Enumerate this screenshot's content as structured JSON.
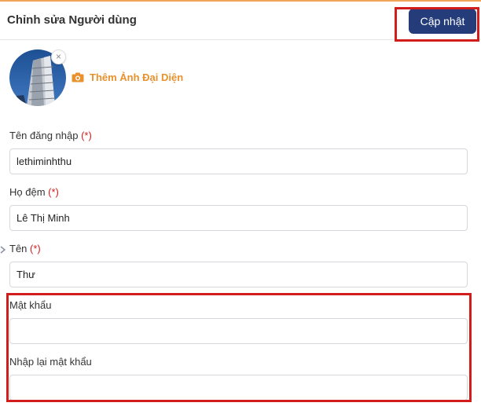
{
  "header": {
    "title": "Chỉnh sửa Người dùng",
    "update_label": "Cập nhật"
  },
  "avatar": {
    "remove_symbol": "×",
    "add_label": "Thêm Ảnh Đại Diện",
    "add_icon": "camera-icon"
  },
  "form": {
    "username": {
      "label": "Tên đăng nhập",
      "required_mark": "(*)",
      "value": "lethiminhthu"
    },
    "middle_name": {
      "label": "Họ đệm",
      "required_mark": "(*)",
      "value": "Lê Thị Minh"
    },
    "first_name": {
      "label": "Tên",
      "required_mark": "(*)",
      "value": "Thư"
    },
    "password": {
      "label": "Mật khẩu",
      "value": ""
    },
    "confirm_password": {
      "label": "Nhập lại mật khẩu",
      "value": ""
    }
  },
  "colors": {
    "accent_orange": "#e8912d",
    "primary_button": "#243d7a",
    "highlight_red": "#d21d1d",
    "required_red": "#d21d1d"
  }
}
